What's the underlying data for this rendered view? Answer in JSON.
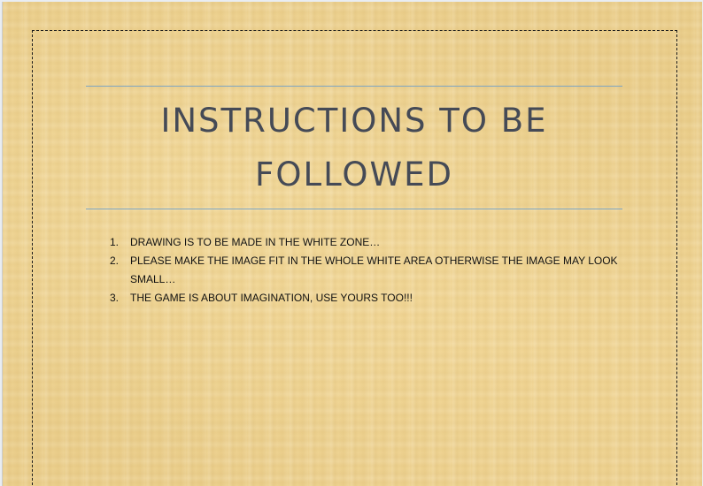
{
  "title": "INSTRUCTIONS TO BE FOLLOWED",
  "instructions": [
    {
      "number": "1.",
      "text": "DRAWING IS TO BE MADE IN THE WHITE ZONE…"
    },
    {
      "number": "2.",
      "text": "PLEASE MAKE THE IMAGE FIT IN THE WHOLE WHITE AREA OTHERWISE THE IMAGE MAY LOOK SMALL…"
    },
    {
      "number": "3.",
      "text": "THE GAME IS ABOUT IMAGINATION, USE YOURS TOO!!!"
    }
  ],
  "colors": {
    "background": "#ecd08e",
    "title_text": "#454a56",
    "rule_lines": "#7fa6c2",
    "body_text": "#111111"
  }
}
